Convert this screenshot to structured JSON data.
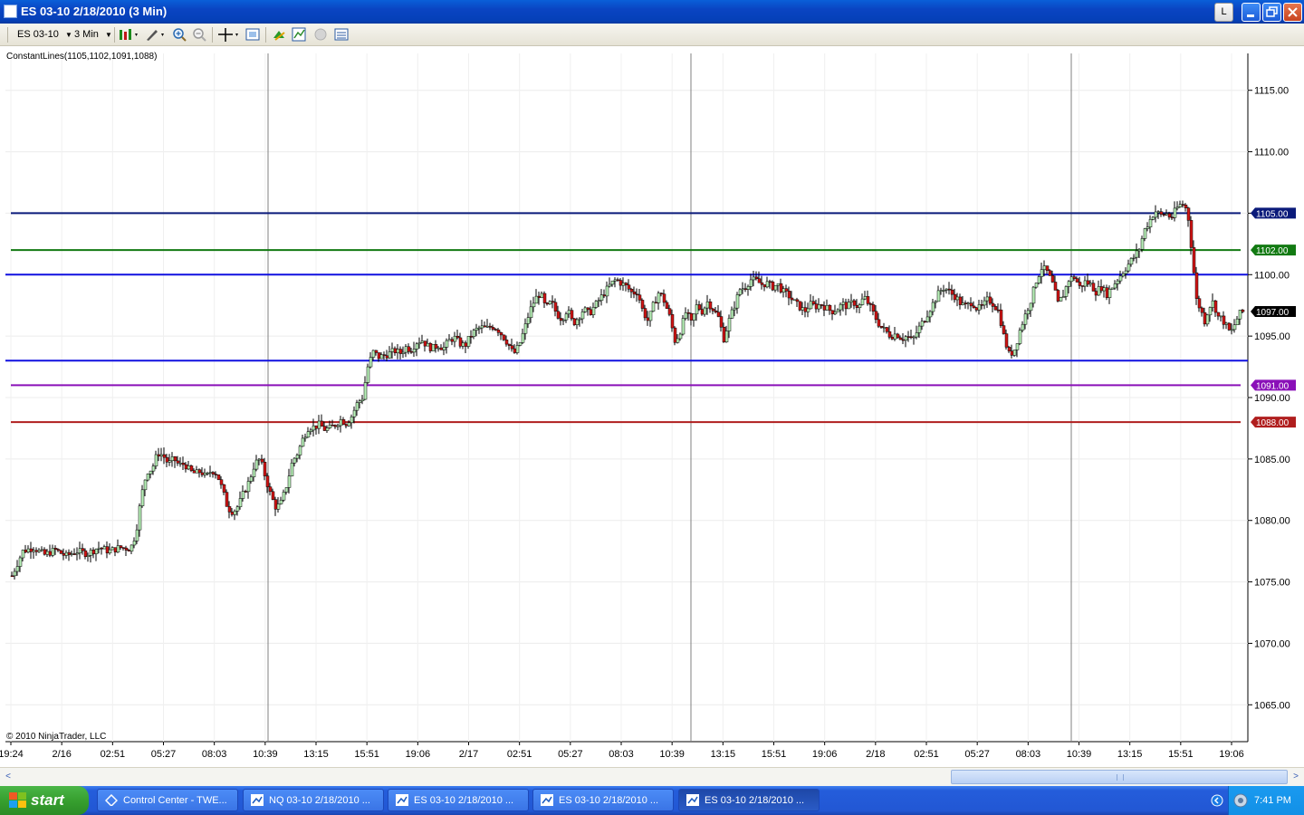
{
  "window": {
    "title": "ES 03-10  2/18/2010 (3 Min)",
    "buttons": {
      "layout": "L"
    }
  },
  "toolbar": {
    "instrument": "ES 03-10",
    "interval": "3 Min"
  },
  "chart": {
    "indicator_label": "ConstantLines(1105,1102,1091,1088)",
    "copyright": "© 2010 NinjaTrader, LLC"
  },
  "chart_data": {
    "type": "candlestick",
    "y_axis": {
      "range": [
        1062,
        1118
      ],
      "ticks": [
        "1115.00",
        "1110.00",
        "1105.00",
        "1100.00",
        "1095.00",
        "1090.00",
        "1085.00",
        "1080.00",
        "1075.00",
        "1070.00",
        "1065.00"
      ]
    },
    "x_axis": {
      "ticks": [
        "19:24",
        "2/16",
        "02:51",
        "05:27",
        "08:03",
        "10:39",
        "13:15",
        "15:51",
        "19:06",
        "2/17",
        "02:51",
        "05:27",
        "08:03",
        "10:39",
        "13:15",
        "15:51",
        "19:06",
        "2/18",
        "02:51",
        "05:27",
        "08:03",
        "10:39",
        "13:15",
        "15:51",
        "19:06"
      ]
    },
    "constant_lines": [
      {
        "value": 1105,
        "label": "1105.00",
        "color": "#0a1a7a"
      },
      {
        "value": 1102,
        "label": "1102.00",
        "color": "#127a12"
      },
      {
        "value": 1091,
        "label": "1091.00",
        "color": "#8a10b8"
      },
      {
        "value": 1088,
        "label": "1088.00",
        "color": "#b01e1e"
      }
    ],
    "extra_horizontal_lines": [
      {
        "value": 1100,
        "color": "#1010e0"
      },
      {
        "value": 1093,
        "color": "#1010e0"
      }
    ],
    "last_price": {
      "value": 1097,
      "label": "1097.00",
      "color": "#000000"
    },
    "price_path": [
      [
        0,
        1075.5
      ],
      [
        10,
        1077.5
      ],
      [
        20,
        1077.8
      ],
      [
        30,
        1077.2
      ],
      [
        40,
        1077.6
      ],
      [
        50,
        1077.1
      ],
      [
        60,
        1077.5
      ],
      [
        70,
        1077.3
      ],
      [
        80,
        1077.8
      ],
      [
        90,
        1077.5
      ],
      [
        100,
        1077.8
      ],
      [
        110,
        1077.7
      ],
      [
        115,
        1079
      ],
      [
        120,
        1082
      ],
      [
        125,
        1084
      ],
      [
        130,
        1084.2
      ],
      [
        135,
        1085.5
      ],
      [
        140,
        1085.3
      ],
      [
        145,
        1084.6
      ],
      [
        150,
        1085.0
      ],
      [
        155,
        1084.5
      ],
      [
        160,
        1084.6
      ],
      [
        165,
        1084.0
      ],
      [
        170,
        1083.8
      ],
      [
        175,
        1084.0
      ],
      [
        180,
        1083.5
      ],
      [
        185,
        1084.1
      ],
      [
        190,
        1083.8
      ],
      [
        195,
        1082.5
      ],
      [
        200,
        1081.0
      ],
      [
        205,
        1080.7
      ],
      [
        210,
        1081.2
      ],
      [
        215,
        1082.3
      ],
      [
        220,
        1083.2
      ],
      [
        225,
        1084.6
      ],
      [
        230,
        1085.0
      ],
      [
        235,
        1083.5
      ],
      [
        240,
        1082.0
      ],
      [
        245,
        1081.0
      ],
      [
        250,
        1081.5
      ],
      [
        255,
        1083.0
      ],
      [
        260,
        1084.8
      ],
      [
        265,
        1085.5
      ],
      [
        270,
        1086.7
      ],
      [
        275,
        1087.6
      ],
      [
        280,
        1087.6
      ],
      [
        285,
        1087.8
      ],
      [
        290,
        1087.4
      ],
      [
        295,
        1087.5
      ],
      [
        300,
        1087.8
      ],
      [
        305,
        1088.2
      ],
      [
        310,
        1087.9
      ],
      [
        315,
        1088.5
      ],
      [
        320,
        1089.5
      ],
      [
        325,
        1090.0
      ],
      [
        330,
        1092.5
      ],
      [
        335,
        1093.7
      ],
      [
        340,
        1093.3
      ],
      [
        345,
        1093.4
      ],
      [
        350,
        1093.6
      ],
      [
        355,
        1093.8
      ],
      [
        360,
        1093.6
      ],
      [
        365,
        1094.1
      ],
      [
        370,
        1093.9
      ],
      [
        375,
        1094.5
      ],
      [
        380,
        1094.7
      ],
      [
        385,
        1094.2
      ],
      [
        390,
        1094.0
      ],
      [
        395,
        1094.3
      ],
      [
        400,
        1094.0
      ],
      [
        405,
        1094.6
      ],
      [
        410,
        1094.9
      ],
      [
        415,
        1094.4
      ],
      [
        420,
        1094.2
      ],
      [
        425,
        1095.0
      ],
      [
        430,
        1095.5
      ],
      [
        435,
        1095.7
      ],
      [
        440,
        1095.6
      ],
      [
        445,
        1095.8
      ],
      [
        450,
        1095.6
      ],
      [
        455,
        1095.0
      ],
      [
        460,
        1094.4
      ],
      [
        465,
        1093.5
      ],
      [
        470,
        1094.2
      ],
      [
        475,
        1095.5
      ],
      [
        480,
        1097.0
      ],
      [
        485,
        1098.0
      ],
      [
        490,
        1098.5
      ],
      [
        495,
        1097.2
      ],
      [
        500,
        1097.8
      ],
      [
        505,
        1096.8
      ],
      [
        510,
        1096.4
      ],
      [
        515,
        1097.2
      ],
      [
        520,
        1096.0
      ],
      [
        525,
        1096.5
      ],
      [
        530,
        1097.2
      ],
      [
        535,
        1096.8
      ],
      [
        540,
        1097.4
      ],
      [
        545,
        1098.0
      ],
      [
        550,
        1098.6
      ],
      [
        555,
        1099.2
      ],
      [
        560,
        1099.6
      ],
      [
        565,
        1099.3
      ],
      [
        570,
        1099.0
      ],
      [
        575,
        1098.5
      ],
      [
        580,
        1098.6
      ],
      [
        585,
        1097.0
      ],
      [
        590,
        1096.2
      ],
      [
        595,
        1097.6
      ],
      [
        600,
        1098.6
      ],
      [
        605,
        1097.8
      ],
      [
        610,
        1096.5
      ],
      [
        615,
        1094.5
      ],
      [
        620,
        1095.5
      ],
      [
        625,
        1097.0
      ],
      [
        630,
        1096.0
      ],
      [
        635,
        1097.5
      ],
      [
        640,
        1097.0
      ],
      [
        645,
        1097.8
      ],
      [
        650,
        1097.2
      ],
      [
        655,
        1096.5
      ],
      [
        660,
        1094.8
      ],
      [
        665,
        1096.3
      ],
      [
        670,
        1097.5
      ],
      [
        675,
        1098.8
      ],
      [
        680,
        1099.0
      ],
      [
        685,
        1099.6
      ],
      [
        690,
        1099.5
      ],
      [
        695,
        1099.2
      ],
      [
        700,
        1099.3
      ],
      [
        705,
        1099.0
      ],
      [
        710,
        1099.2
      ],
      [
        715,
        1098.6
      ],
      [
        720,
        1098.3
      ],
      [
        725,
        1097.8
      ],
      [
        730,
        1097.4
      ],
      [
        735,
        1097.0
      ],
      [
        740,
        1097.6
      ],
      [
        745,
        1097.4
      ],
      [
        750,
        1097.6
      ],
      [
        755,
        1097.3
      ],
      [
        760,
        1097.0
      ],
      [
        765,
        1097.2
      ],
      [
        770,
        1097.6
      ],
      [
        775,
        1097.4
      ],
      [
        780,
        1097.8
      ],
      [
        785,
        1097.3
      ],
      [
        790,
        1098.2
      ],
      [
        795,
        1097.5
      ],
      [
        800,
        1096.6
      ],
      [
        805,
        1095.8
      ],
      [
        810,
        1095.4
      ],
      [
        815,
        1095.0
      ],
      [
        820,
        1095.2
      ],
      [
        825,
        1094.8
      ],
      [
        830,
        1095.0
      ],
      [
        835,
        1094.6
      ],
      [
        840,
        1095.5
      ],
      [
        845,
        1096.2
      ],
      [
        850,
        1097.0
      ],
      [
        855,
        1097.8
      ],
      [
        860,
        1098.6
      ],
      [
        865,
        1099.0
      ],
      [
        870,
        1098.5
      ],
      [
        875,
        1098.2
      ],
      [
        880,
        1097.6
      ],
      [
        885,
        1097.4
      ],
      [
        890,
        1097.8
      ],
      [
        895,
        1097.2
      ],
      [
        900,
        1097.4
      ],
      [
        905,
        1098.0
      ],
      [
        910,
        1097.6
      ],
      [
        915,
        1097.0
      ],
      [
        920,
        1094.8
      ],
      [
        925,
        1093.4
      ],
      [
        930,
        1094.0
      ],
      [
        935,
        1095.6
      ],
      [
        940,
        1096.8
      ],
      [
        945,
        1098.0
      ],
      [
        950,
        1099.6
      ],
      [
        955,
        1100.6
      ],
      [
        960,
        1100.2
      ],
      [
        965,
        1099.2
      ],
      [
        970,
        1097.6
      ],
      [
        975,
        1098.4
      ],
      [
        980,
        1099.6
      ],
      [
        985,
        1099.8
      ],
      [
        990,
        1099.0
      ],
      [
        995,
        1099.4
      ],
      [
        1000,
        1099.2
      ],
      [
        1005,
        1098.6
      ],
      [
        1010,
        1099.0
      ],
      [
        1015,
        1098.4
      ],
      [
        1020,
        1099.0
      ],
      [
        1025,
        1099.6
      ],
      [
        1030,
        1100.2
      ],
      [
        1035,
        1100.8
      ],
      [
        1040,
        1101.4
      ],
      [
        1045,
        1102.0
      ],
      [
        1050,
        1103.6
      ],
      [
        1055,
        1104.4
      ],
      [
        1060,
        1105.2
      ],
      [
        1065,
        1104.8
      ],
      [
        1070,
        1105.0
      ],
      [
        1075,
        1104.6
      ],
      [
        1080,
        1105.4
      ],
      [
        1085,
        1105.8
      ],
      [
        1090,
        1105.2
      ],
      [
        1095,
        1101.0
      ],
      [
        1098,
        1098.0
      ],
      [
        1102,
        1097.2
      ],
      [
        1106,
        1096.2
      ],
      [
        1110,
        1097.4
      ],
      [
        1114,
        1097.8
      ],
      [
        1118,
        1096.6
      ],
      [
        1122,
        1096.4
      ],
      [
        1126,
        1095.8
      ],
      [
        1130,
        1095.2
      ],
      [
        1134,
        1096.0
      ],
      [
        1138,
        1096.8
      ],
      [
        1142,
        1097.0
      ]
    ]
  },
  "scrollbar": {
    "left_arrow": "<",
    "right_arrow": ">"
  },
  "taskbar": {
    "start_label": "start",
    "tasks": [
      {
        "label": "Control Center - TWE..."
      },
      {
        "label": "NQ 03-10  2/18/2010 ..."
      },
      {
        "label": "ES 03-10  2/18/2010 ..."
      },
      {
        "label": "ES 03-10  2/18/2010 ..."
      },
      {
        "label": "ES 03-10  2/18/2010 ..."
      }
    ],
    "clock": "7:41 PM"
  }
}
